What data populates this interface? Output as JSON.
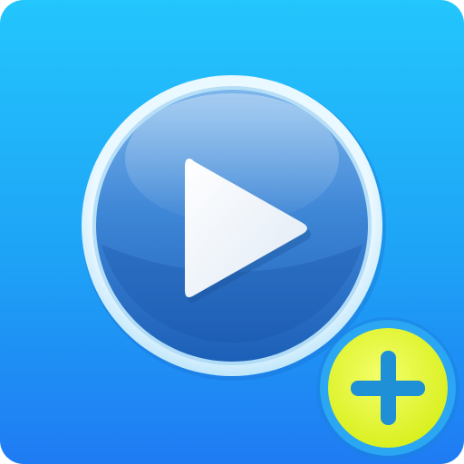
{
  "icon": {
    "name": "video-player-add-app-icon",
    "colors": {
      "background_top": "#23c4fc",
      "background_bottom": "#1f7af5",
      "ring_outer": "#d9f1fc",
      "button_top": "#6aa8e6",
      "button_bottom": "#1f63bb",
      "play": "#ffffff",
      "badge_fill": "#e9ff3a",
      "badge_ring": "#2ea8f2",
      "plus": "#1f8fd6"
    },
    "glyphs": {
      "play": "play-icon",
      "plus": "plus-icon"
    }
  }
}
